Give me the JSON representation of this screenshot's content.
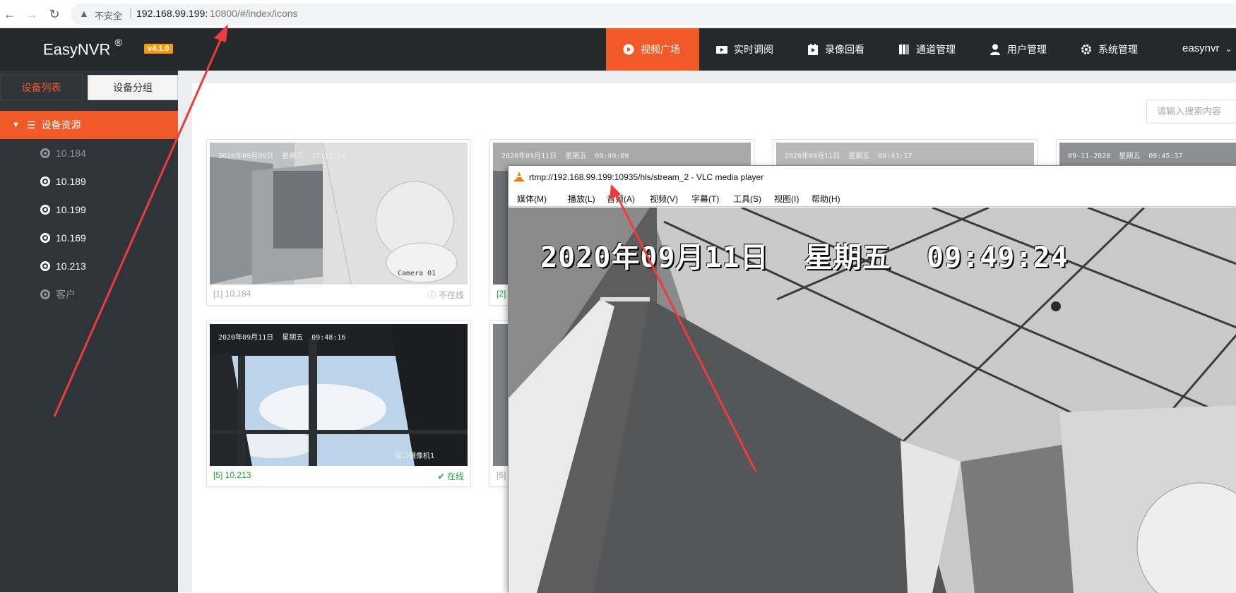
{
  "browser": {
    "insecure_label": "不安全",
    "url_host": "192.168.99.199:",
    "url_rest": "10800/#/index/icons"
  },
  "header": {
    "logo": "EasyNVR",
    "logo_mark": "®",
    "version": "v4.1.0",
    "nav": [
      {
        "label": "视频广场",
        "icon": "play-circle-icon"
      },
      {
        "label": "实时调阅",
        "icon": "video-camera-icon"
      },
      {
        "label": "录像回看",
        "icon": "playback-icon"
      },
      {
        "label": "通道管理",
        "icon": "channels-icon"
      },
      {
        "label": "用户管理",
        "icon": "user-icon"
      },
      {
        "label": "系统管理",
        "icon": "gear-icon"
      }
    ],
    "user": "easynvr"
  },
  "sidebar": {
    "tabs": [
      "设备列表",
      "设备分组"
    ],
    "root": "设备资源",
    "items": [
      {
        "label": "10.184",
        "status": "offline"
      },
      {
        "label": "10.189",
        "status": "online"
      },
      {
        "label": "10.199",
        "status": "online"
      },
      {
        "label": "10.169",
        "status": "online"
      },
      {
        "label": "10.213",
        "status": "online"
      },
      {
        "label": "客户",
        "status": "offline"
      }
    ]
  },
  "search": {
    "placeholder": "请输入搜索内容"
  },
  "cards": [
    {
      "name": "[1] 10.184",
      "status": "不在线",
      "osd": "2020年09月09日  星期三  17:11:26",
      "cam_label": "Camera 01"
    },
    {
      "name": "[2]",
      "osd": "2020年09月11日  星期五  09:49:09"
    },
    {
      "osd": "2020年09月11日  星期五  09:43:17"
    },
    {
      "osd": "09-11-2020  星期五  09:45:37"
    },
    {
      "name": "[5] 10.213",
      "status": "在线",
      "osd": "2020年09月11日  星期五  09:48:16",
      "cam_label": "窗口摄像机1"
    },
    {
      "name": "[6]"
    }
  ],
  "vlc": {
    "title": "rtmp://192.168.99.199:10935/hls/stream_2 - VLC media player",
    "menu": [
      "媒体(M)",
      "播放(L)",
      "音频(A)",
      "视频(V)",
      "字幕(T)",
      "工具(S)",
      "视图(I)",
      "帮助(H)"
    ],
    "osd": "2020年09月11日  星期五  09:49:24"
  },
  "colors": {
    "accent": "#f05a28",
    "online": "#1e9e3a",
    "offline": "#aaaaaa",
    "header_bg": "#25292c",
    "sidebar_bg": "#2f3438",
    "annotation_arrow": "#ef3b3b"
  }
}
